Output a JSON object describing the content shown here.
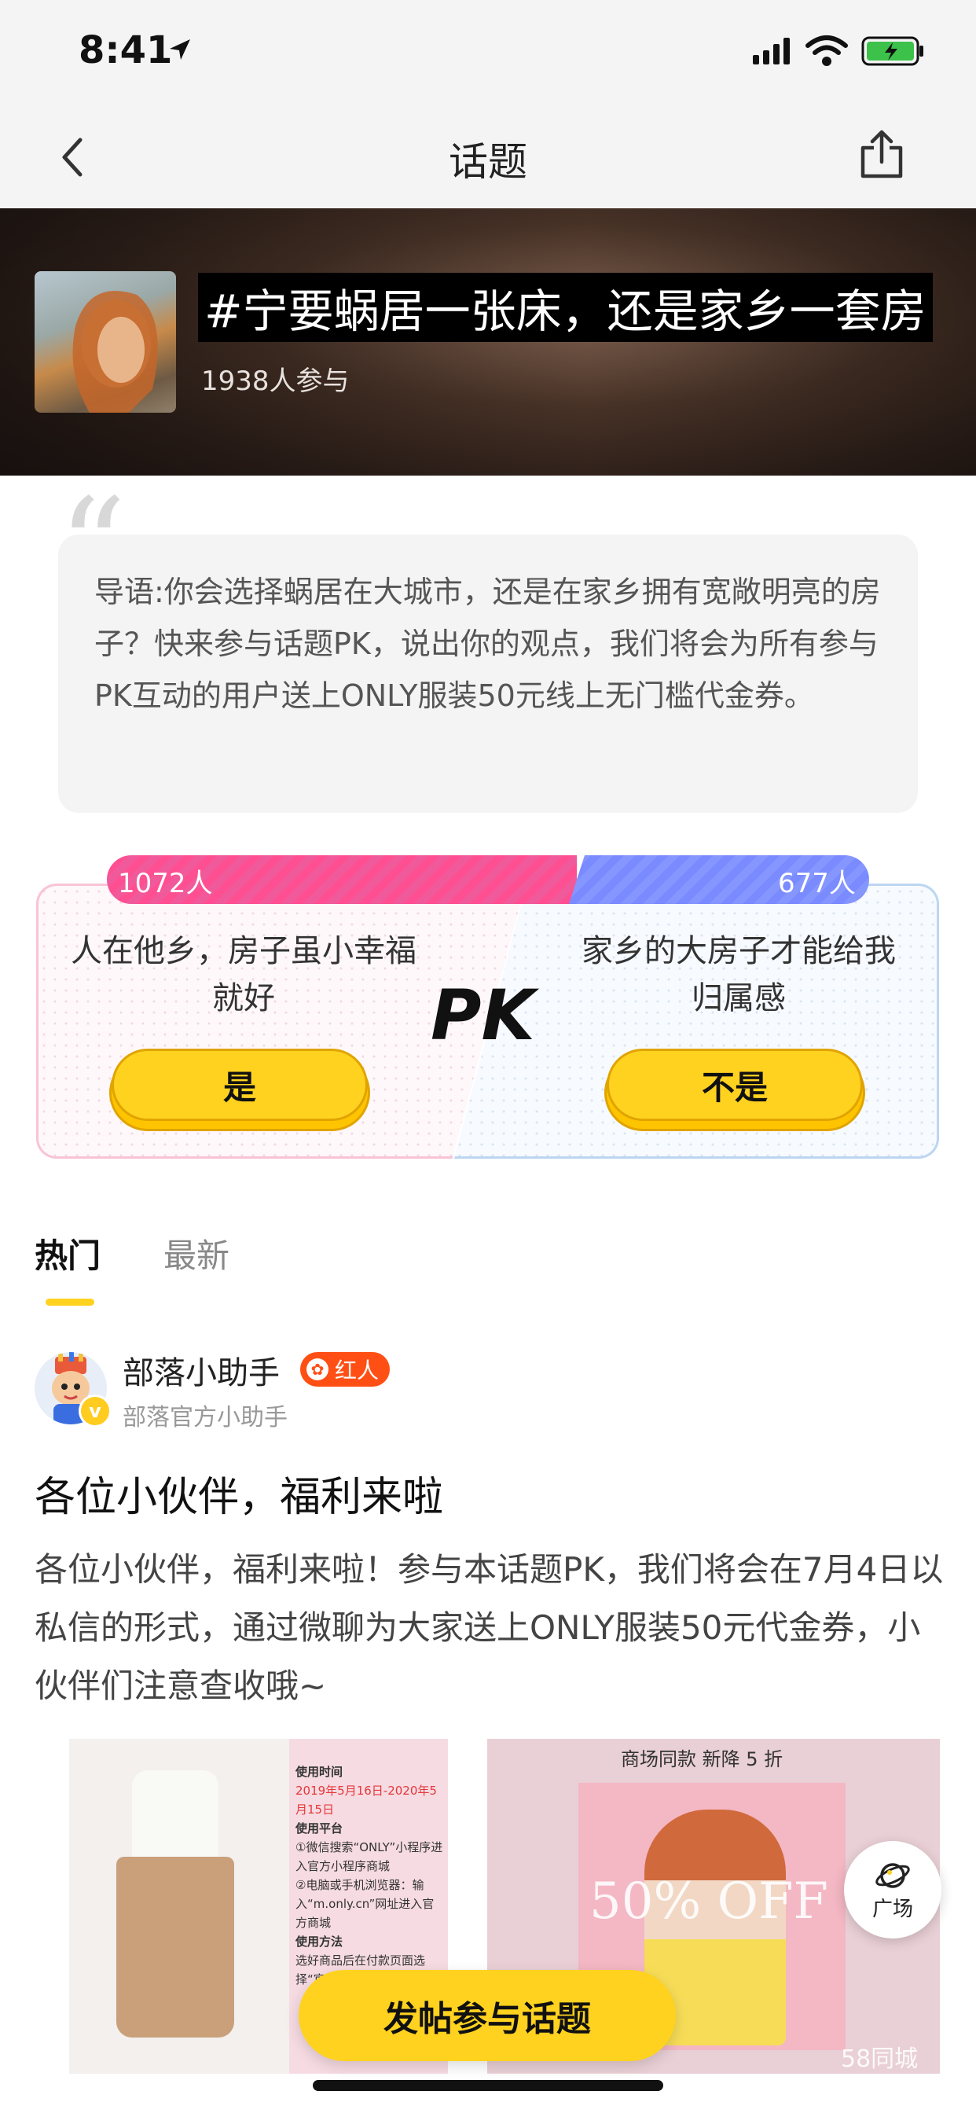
{
  "status_bar": {
    "time": "8:41"
  },
  "nav": {
    "title": "话题"
  },
  "topic": {
    "title": "#宁要蜗居一张床，还是家乡一套房",
    "participants": "1938人参与"
  },
  "intro": {
    "text": "导语:你会选择蜗居在大城市，还是在家乡拥有宽敞明亮的房子？快来参与话题PK，说出你的观点，我们将会为所有参与PK互动的用户送上ONLY服装50元线上无门槛代金券。"
  },
  "pk": {
    "left_count": "1072人",
    "right_count": "677人",
    "left_share": 0.613,
    "left_option": "人在他乡，房子虽小幸福就好",
    "right_option": "家乡的大房子才能给我归属感",
    "label": "PK",
    "yes_label": "是",
    "no_label": "不是",
    "colors": {
      "left": "#ff4f93",
      "right": "#7a8bff",
      "button": "#ffd21f"
    }
  },
  "tabs": [
    {
      "label": "热门",
      "active": true
    },
    {
      "label": "最新",
      "active": false
    }
  ],
  "post": {
    "author": "部落小助手",
    "badge": "红人",
    "author_subtitle": "部落官方小助手",
    "title": "各位小伙伴，福利来啦",
    "body": "各位小伙伴，福利来啦！参与本话题PK，我们将会在7月4日以私信的形式，通过微聊为大家送上ONLY服装50元代金券，小伙伴们注意查收哦~",
    "image1_info": {
      "step1": "使用时间",
      "step1_detail": "2019年5月16日-2020年5月15日",
      "step2": "使用平台",
      "step2_detail_a": "①微信搜索“ONLY”小程序进入官方小程序商城",
      "step2_detail_b": "②电脑或手机浏览器：输入“m.only.cn”网址进入官方商城",
      "step3": "使用方法",
      "step3_detail": "选好商品后在付款页面选择“官网"
    },
    "image2_text": {
      "top": "商场同款 新降 5 折",
      "sale": "50% OFF",
      "watermark": "58同城"
    }
  },
  "floating": {
    "plaza_label": "广场"
  },
  "cta": {
    "label": "发帖参与话题"
  }
}
